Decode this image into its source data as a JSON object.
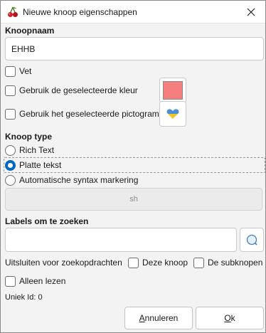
{
  "window": {
    "title": "Nieuwe knoop eigenschappen"
  },
  "name_section": {
    "title": "Knoopnaam",
    "value": "EHHB"
  },
  "options": {
    "bold_label": "Vet",
    "use_color_label": "Gebruik de geselecteerde kleur",
    "use_icon_label": "Gebruik het geselecteerde pictogram",
    "selected_color": "#f57e7e"
  },
  "type_section": {
    "title": "Knoop type",
    "options": [
      "Rich Text",
      "Platte tekst",
      "Automatische syntax markering"
    ],
    "selected": "Platte tekst",
    "syntax_value": "sh"
  },
  "labels_section": {
    "title": "Labels om te zoeken",
    "value": ""
  },
  "exclude": {
    "label": "Uitsluiten voor zoekopdrachten",
    "this_node_label": "Deze knoop",
    "subnodes_label": "De subknopen"
  },
  "readonly_label": "Alleen lezen",
  "unique_id": "Uniek Id: 0",
  "buttons": {
    "cancel": "Annuleren",
    "ok": "Ok"
  },
  "colors": {
    "accent": "#0067c0",
    "heart_top": "#4a8fd6",
    "heart_bottom": "#f2c522"
  }
}
